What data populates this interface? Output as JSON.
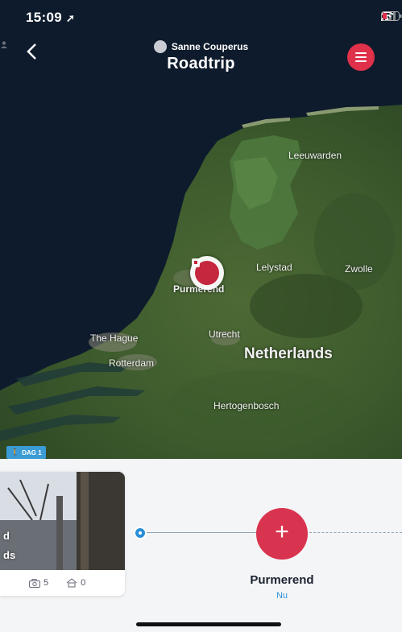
{
  "status_bar": {
    "time": "15:09"
  },
  "header": {
    "owner_name": "Sanne Couperus",
    "title": "Roadtrip",
    "back_icon": "chevron-left-icon",
    "menu_icon": "hamburger-icon",
    "accent_color": "#e0314b"
  },
  "map": {
    "labels": {
      "leeuwarden": "Leeuwarden",
      "lelystad": "Lelystad",
      "zwolle": "Zwolle",
      "purmerend": "Purmerend",
      "the_hague": "The Hague",
      "utrecht": "Utrecht",
      "rotterdam": "Rotterdam",
      "netherlands": "Netherlands",
      "hertogenbosch": "Hertogenbosch"
    },
    "day_tag": "DAG 1"
  },
  "timeline": {
    "card_photo_text_1": "d",
    "card_photo_text_2": "ds",
    "photo_count": "5",
    "other_count": "0",
    "place_name": "Purmerend",
    "place_time": "Nu",
    "add_label": "+"
  }
}
